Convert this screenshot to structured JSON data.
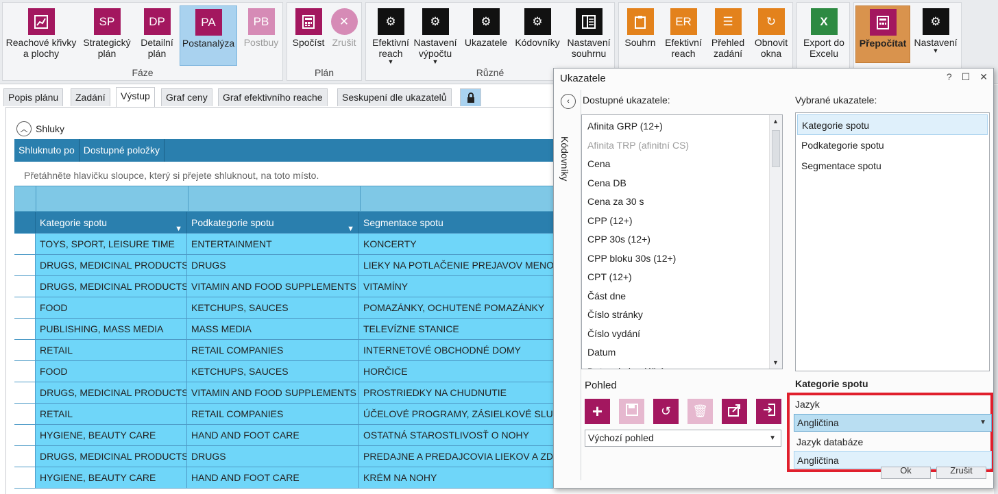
{
  "ribbon": {
    "groups": {
      "faze": "Fáze",
      "plan": "Plán",
      "ruzne": "Různé"
    },
    "buttons": {
      "reach": "Reachové křivky a plochy",
      "sp_abbr": "SP",
      "sp": "Strategický plán",
      "dp_abbr": "DP",
      "dp": "Detailní plán",
      "pa_abbr": "PA",
      "pa": "Postanalýza",
      "pb_abbr": "PB",
      "pb": "Postbuy",
      "spocist": "Spočíst",
      "zrusit": "Zrušit",
      "efektivni_reach": "Efektivní reach",
      "nastaveni_vypoctu": "Nastavení výpočtu",
      "ukazatele": "Ukazatele",
      "kodovniky": "Kódovníky",
      "nastaveni_souhrnu": "Nastavení souhrnu",
      "souhrn": "Souhrn",
      "er_abbr": "ER",
      "efektivni_reach2": "Efektivní reach",
      "prehled_zadani": "Přehled zadání",
      "obnovit_okna": "Obnovit okna",
      "export_excel": "Export do Excelu",
      "excel_abbr": "X",
      "prepocitat": "Přepočítat",
      "nastaveni": "Nastavení"
    }
  },
  "tabs": [
    "Popis plánu",
    "Zadání",
    "Výstup",
    "Graf ceny",
    "Graf efektivního reache",
    "Seskupení dle ukazatelů"
  ],
  "main": {
    "section_title": "Shluky",
    "group_bar": [
      "Shluknuto po",
      "Dostupné položky"
    ],
    "drag_hint": "Přetáhněte hlavičku sloupce, který si přejete shluknout, na toto místo.",
    "columns": [
      "Kategorie spotu",
      "Podkategorie spotu",
      "Segmentace spotu"
    ],
    "rows": [
      [
        "TOYS, SPORT, LEISURE TIME",
        "ENTERTAINMENT",
        "KONCERTY"
      ],
      [
        "DRUGS, MEDICINAL PRODUCTS",
        "DRUGS",
        "LIEKY NA POTLAČENIE PREJAVOV MENOP"
      ],
      [
        "DRUGS, MEDICINAL PRODUCTS",
        "VITAMIN AND FOOD SUPPLEMENTS",
        "VITAMÍNY"
      ],
      [
        "FOOD",
        "KETCHUPS, SAUCES",
        "POMAZÁNKY, OCHUTENÉ POMAZÁNKY"
      ],
      [
        "PUBLISHING, MASS MEDIA",
        "MASS MEDIA",
        "TELEVÍZNE STANICE"
      ],
      [
        "RETAIL",
        "RETAIL COMPANIES",
        "INTERNETOVÉ OBCHODNÉ DOMY"
      ],
      [
        "FOOD",
        "KETCHUPS, SAUCES",
        "HORČICE"
      ],
      [
        "DRUGS, MEDICINAL PRODUCTS",
        "VITAMIN AND FOOD SUPPLEMENTS",
        "PROSTRIEDKY NA CHUDNUTIE"
      ],
      [
        "RETAIL",
        "RETAIL COMPANIES",
        "ÚČELOVÉ PROGRAMY, ZÁSIELKOVÉ SLUŽE"
      ],
      [
        "HYGIENE, BEAUTY CARE",
        "HAND AND FOOT CARE",
        "OSTATNÁ STAROSTLIVOSŤ O NOHY"
      ],
      [
        "DRUGS, MEDICINAL PRODUCTS",
        "DRUGS",
        "PREDAJNE A PREDAJCOVIA LIEKOV A ZDR"
      ],
      [
        "HYGIENE, BEAUTY CARE",
        "HAND AND FOOT CARE",
        "KRÉM NA NOHY"
      ]
    ]
  },
  "dialog": {
    "title": "Ukazatele",
    "help": "?",
    "side_label": "Kódovníky",
    "available_label": "Dostupné ukazatele:",
    "selected_label": "Vybrané ukazatele:",
    "available": [
      "Afinita GRP (12+)",
      "Afinita TRP (afinitní CS)",
      "Cena",
      "Cena DB",
      "Cena za 30 s",
      "CPP (12+)",
      "CPP 30s (12+)",
      "CPP bloku 30s (12+)",
      "CPT (12+)",
      "Část dne",
      "Číslo stránky",
      "Číslo vydání",
      "Datum",
      "Datum kalendářní"
    ],
    "selected": [
      "Kategorie spotu",
      "Podkategorie spotu",
      "Segmentace spotu"
    ],
    "pohled_label": "Pohled",
    "view_value": "Výchozí pohled",
    "category_title": "Kategorie spotu",
    "language_label": "Jazyk",
    "language_value": "Angličtina",
    "language_options": [
      "Jazyk databáze",
      "Angličtina"
    ],
    "ok": "Ok",
    "cancel": "Zrušit"
  }
}
